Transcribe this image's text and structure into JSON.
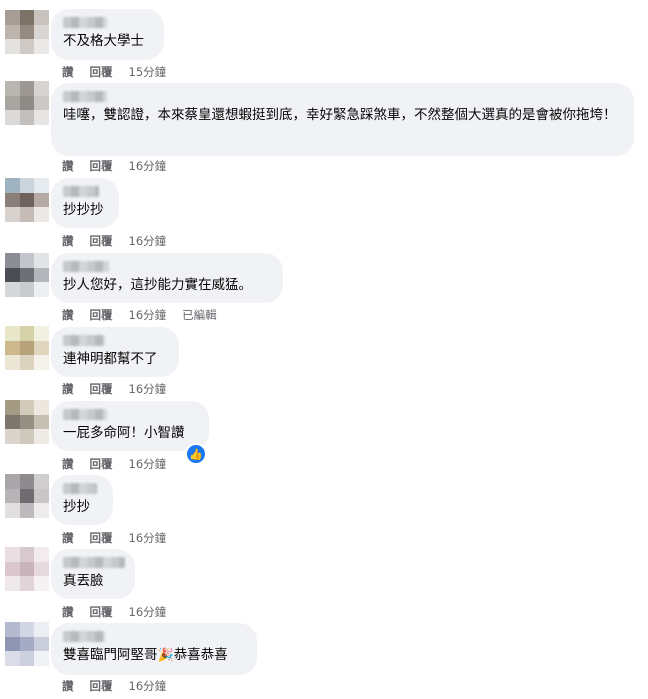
{
  "comments": [
    {
      "text": "不及格大學士",
      "reply_label": "回覆",
      "like_label": "讚",
      "time": "15分鐘",
      "avatar_colors": [
        "#a79d95",
        "#7c7268",
        "#c8c3be",
        "#bdb5ad",
        "#948a82",
        "#d9d5d2",
        "#e4e2df",
        "#cfcac6",
        "#ebe9e7"
      ]
    },
    {
      "text": "哇噻，雙認證，本來蔡皇還想蝦挺到底，幸好緊急踩煞車，不然整個大選真的是會被你拖垮！",
      "reply_label": "回覆",
      "like_label": "讚",
      "time": "16分鐘",
      "avatar_colors": [
        "#b9b5b1",
        "#9d9893",
        "#d6d3d0",
        "#a8a4a0",
        "#8e8a86",
        "#cbc8c5",
        "#dcdad8",
        "#c2bfbc",
        "#e8e6e4"
      ]
    },
    {
      "text": "抄抄抄",
      "reply_label": "回覆",
      "like_label": "讚",
      "time": "16分鐘",
      "avatar_colors": [
        "#9fb2c0",
        "#c9d4dc",
        "#e6ebef",
        "#8c7f79",
        "#6f625d",
        "#b6aaa4",
        "#d8d2cf",
        "#c6bcb7",
        "#ece8e6"
      ]
    },
    {
      "text": "抄人您好，這抄能力實在威猛。",
      "reply_label": "回覆",
      "like_label": "讚",
      "time": "16分鐘",
      "edited": "已編輯",
      "avatar_colors": [
        "#8b8f94",
        "#c3c6ca",
        "#e2e4e6",
        "#4a4e54",
        "#6d7177",
        "#b3b6ba",
        "#d5d7d9",
        "#c9cbce",
        "#eeeff0"
      ]
    },
    {
      "text": "連神明都幫不了",
      "reply_label": "回覆",
      "like_label": "讚",
      "time": "16分鐘",
      "avatar_colors": [
        "#e9e7c9",
        "#d6d2a8",
        "#f2f0e0",
        "#cdb98e",
        "#b7a37a",
        "#e0d6bd",
        "#ebe6d6",
        "#dcd3bf",
        "#f4f2ea"
      ]
    },
    {
      "text": "一屁多命阿！小智讚",
      "reply_label": "回覆",
      "like_label": "讚",
      "time": "16分鐘",
      "avatar_colors": [
        "#a59a84",
        "#d3cbb9",
        "#ece8df",
        "#7b776d",
        "#958f83",
        "#c6c0b3",
        "#d9d5cc",
        "#cfc9bd",
        "#eeebe6"
      ]
    },
    {
      "text": "抄抄",
      "reply_label": "回覆",
      "like_label": "讚",
      "time": "16分鐘",
      "avatar_colors": [
        "#a9a5a8",
        "#8e8a8d",
        "#d0cdcf",
        "#b7b3b6",
        "#6f6b6e",
        "#c9c6c8",
        "#e1dfe0",
        "#bdb9bc",
        "#edebec"
      ]
    },
    {
      "text": "真丟臉",
      "reply_label": "回覆",
      "like_label": "讚",
      "time": "16分鐘",
      "avatar_colors": [
        "#e9dfe3",
        "#d8c9cf",
        "#f2ecee",
        "#d9c7cd",
        "#c8b3bb",
        "#e7dadf",
        "#efe8eb",
        "#e1d4d9",
        "#f6f2f4"
      ]
    },
    {
      "text": "雙喜臨門阿堅哥",
      "text_after": "恭喜恭喜",
      "emoji": "🎉",
      "reply_label": "回覆",
      "like_label": "讚",
      "time": "16分鐘",
      "avatar_colors": [
        "#b6bace",
        "#d3d6e3",
        "#eceef4",
        "#8e95b3",
        "#a5abc4",
        "#c9cddc",
        "#dadde8",
        "#cdd1df",
        "#f1f2f6"
      ]
    }
  ]
}
